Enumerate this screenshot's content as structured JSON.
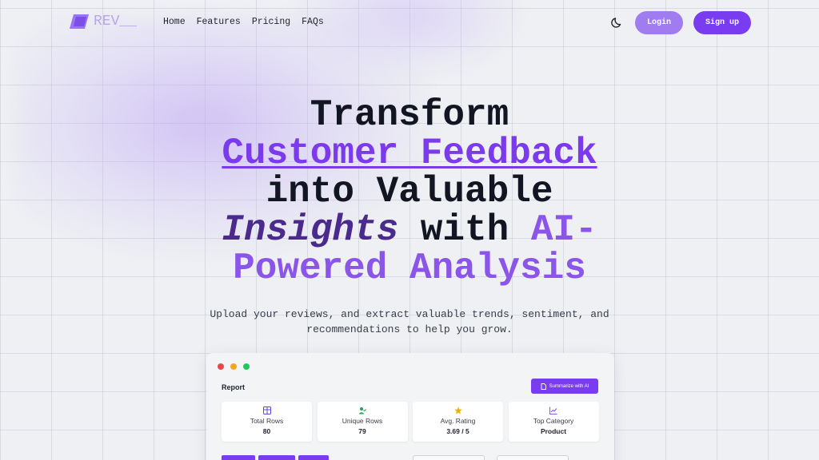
{
  "brand": {
    "name": "REV__",
    "accent": "#7a3cf0"
  },
  "nav": {
    "links": [
      "Home",
      "Features",
      "Pricing",
      "FAQs"
    ],
    "theme_icon": "moon-icon",
    "login_label": "Login",
    "signup_label": "Sign up"
  },
  "hero": {
    "line1": "Transform",
    "line2": "Customer Feedback",
    "line3": "into Valuable",
    "line4_a": "Insights",
    "line4_b": " with ",
    "line4_c": "AI-",
    "line5": "Powered Analysis",
    "subtitle": "Upload your reviews, and extract valuable trends, sentiment, and recommendations to help you grow."
  },
  "preview": {
    "window_dots": [
      "#e5484d",
      "#f5a524",
      "#22c55e"
    ],
    "title": "Report",
    "summarize_label": "Summarize with AI",
    "stats": [
      {
        "icon": "table-icon",
        "label": "Total Rows",
        "value": "80"
      },
      {
        "icon": "user-check-icon",
        "label": "Unique Rows",
        "value": "79"
      },
      {
        "icon": "star-icon",
        "label": "Avg. Rating",
        "value": "3.69 / 5"
      },
      {
        "icon": "trend-chart-icon",
        "label": "Top Category",
        "value": "Product"
      }
    ]
  }
}
